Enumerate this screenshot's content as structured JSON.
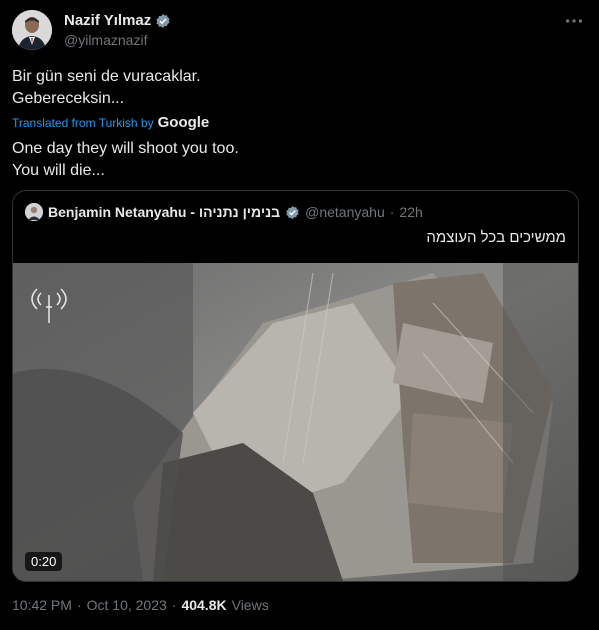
{
  "author": {
    "name": "Nazif Yılmaz",
    "handle": "@yilmaznazif"
  },
  "tweet": {
    "text_line1": "Bir gün seni de vuracaklar.",
    "text_line2": "Gebereceksin...",
    "translated_label": "Translated from Turkish by",
    "translator": "Google",
    "translation_line1": "One day they will shoot you too.",
    "translation_line2": "You will die..."
  },
  "quote": {
    "name": "Benjamin Netanyahu - בנימין נתניהו",
    "handle": "@netanyahu",
    "separator": "·",
    "time": "22h",
    "text": "ממשיכים בכל העוצמה",
    "video_duration": "0:20"
  },
  "meta": {
    "time": "10:42 PM",
    "sep1": "·",
    "date": "Oct 10, 2023",
    "sep2": "·",
    "views_count": "404.8K",
    "views_label": "Views"
  },
  "colors": {
    "background": "#000000",
    "text": "#e7e9ea",
    "secondary": "#71767b",
    "accent": "#1d9bf0",
    "border": "#2f3336"
  }
}
